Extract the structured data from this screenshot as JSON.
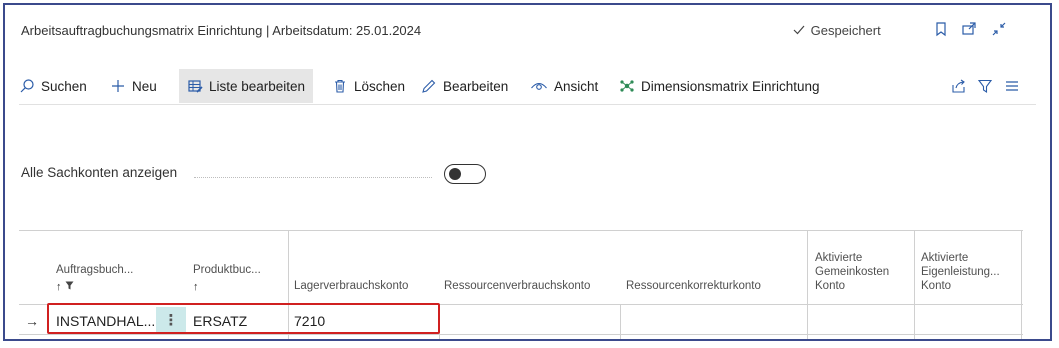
{
  "window": {
    "title": "Arbeitsauftragbuchungsmatrix Einrichtung | Arbeitsdatum: 25.01.2024",
    "status_text": "Gespeichert",
    "status_icon": "checkmark-icon",
    "title_icons": [
      "bookmark-icon",
      "open-new-window-icon",
      "collapse-icon"
    ]
  },
  "toolbar": {
    "search_label": "Suchen",
    "new_label": "Neu",
    "edit_list_label": "Liste bearbeiten",
    "delete_label": "Löschen",
    "edit_label": "Bearbeiten",
    "view_label": "Ansicht",
    "dimensions_label": "Dimensionsmatrix Einrichtung",
    "right_icons": [
      "share-icon",
      "filter-icon",
      "list-view-icon"
    ]
  },
  "options": {
    "show_all_label": "Alle Sachkonten anzeigen",
    "show_all_value": false
  },
  "table": {
    "columns": [
      {
        "label": "Auftragsbuch...",
        "sort": "↑"
      },
      {
        "label": "Produktbuc...",
        "sort": "↑"
      },
      {
        "label": "Lagerverbrauchskonto"
      },
      {
        "label": "Ressourcenverbrauchskonto"
      },
      {
        "label": "Ressourcenkorrekturkonto"
      },
      {
        "label": "Aktivierte Gemeinkosten Konto"
      },
      {
        "label": "Aktivierte Eigenleistung... Konto"
      }
    ],
    "rows": [
      {
        "auftragsbuchung": "INSTANDHAL...",
        "produktbuchung": "ERSATZ",
        "lagerverbrauchskonto": "7210",
        "ressourcenverbrauchskonto": "",
        "ressourcenkorrekturkonto": "",
        "aktivierte_gemeinkosten": "",
        "aktivierte_eigenleistung": ""
      }
    ],
    "row_indicator": "→",
    "row_menu": "⋮"
  }
}
